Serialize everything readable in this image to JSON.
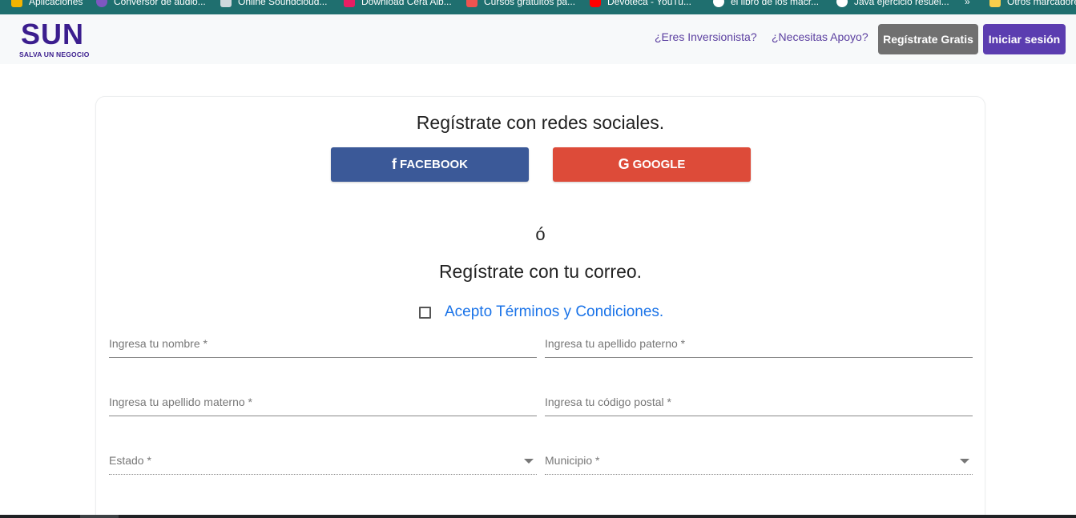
{
  "bookmarks": [
    {
      "label": "Aplicaciones",
      "icon": "apps-grid-icon",
      "color": "#f4b400"
    },
    {
      "label": "Conversor de audio...",
      "icon": "globe-icon",
      "color": "#7e57c2"
    },
    {
      "label": "Online Soundcloud...",
      "icon": "page-icon",
      "color": "#cfd8dc"
    },
    {
      "label": "Download Cera Alb...",
      "icon": "download-icon",
      "color": "#e91e63"
    },
    {
      "label": "Cursos gratuitos pa...",
      "icon": "course-icon",
      "color": "#ef5350"
    },
    {
      "label": "Devoteca - YouTu...",
      "icon": "youtube-icon",
      "color": "#ff0000"
    },
    {
      "label": "el libro de los macr...",
      "icon": "book-icon",
      "color": "#ffffff"
    },
    {
      "label": "Java ejercicio resuel...",
      "icon": "java-icon",
      "color": "#ffffff"
    },
    {
      "label": "»",
      "icon": "more-icon",
      "color": "transparent"
    },
    {
      "label": "Otros marcadores",
      "icon": "folder-icon",
      "color": "#f9ce4c"
    }
  ],
  "navbar": {
    "logo_big": "SUN",
    "logo_small": "SALVA UN NEGOCIO",
    "link_investor": "¿Eres Inversionista?",
    "link_support": "¿Necesitas Apoyo?",
    "register_button": "Regístrate Gratis",
    "login_button": "Iniciar sesión"
  },
  "form": {
    "social_heading": "Regístrate con redes sociales.",
    "facebook": {
      "icon_glyph": "f",
      "label": "FACEBOOK"
    },
    "google": {
      "icon_glyph": "G",
      "label": "GOOGLE"
    },
    "or_text": "ó",
    "email_heading": "Regístrate con tu correo.",
    "terms_label": "Acepto Términos y Condiciones.",
    "terms_checked": false,
    "fields": {
      "nombre": "Ingresa tu nombre *",
      "apellido_paterno": "Ingresa tu apellido paterno *",
      "apellido_materno": "Ingresa tu apellido materno *",
      "codigo_postal": "Ingresa tu código postal *",
      "estado": "Estado *",
      "municipio": "Municipio *"
    }
  },
  "colors": {
    "brand_purple": "#3b1e8e",
    "login_purple": "#5b3db0",
    "register_gray": "#707070",
    "facebook_blue": "#3b5998",
    "google_red": "#dd4b39",
    "link_blue": "#1a73e8"
  }
}
